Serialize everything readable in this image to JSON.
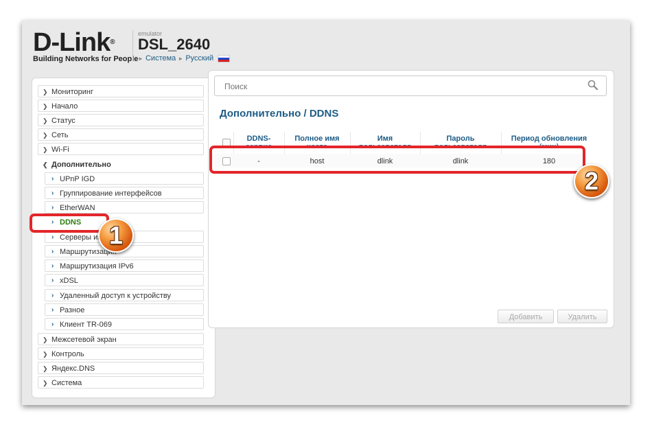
{
  "header": {
    "logo_text": "D-Link",
    "logo_reg": "®",
    "logo_tagline": "Building Networks for People",
    "emulator_label": "emulator",
    "model": "DSL_2640",
    "crumb_system": "Система",
    "crumb_language": "Русский"
  },
  "sidebar": {
    "items": [
      {
        "label": "Мониторинг"
      },
      {
        "label": "Начало"
      },
      {
        "label": "Статус"
      },
      {
        "label": "Сеть"
      },
      {
        "label": "Wi-Fi"
      },
      {
        "label": "Дополнительно"
      },
      {
        "label": "UPnP IGD"
      },
      {
        "label": "Группирование интерфейсов"
      },
      {
        "label": "EtherWAN"
      },
      {
        "label": "DDNS"
      },
      {
        "label": "Серверы имён"
      },
      {
        "label": "Маршрутизация"
      },
      {
        "label": "Маршрутизация IPv6"
      },
      {
        "label": "xDSL"
      },
      {
        "label": "Удаленный доступ к устройству"
      },
      {
        "label": "Разное"
      },
      {
        "label": "Клиент TR-069"
      },
      {
        "label": "Межсетевой экран"
      },
      {
        "label": "Контроль"
      },
      {
        "label": "Яндекс.DNS"
      },
      {
        "label": "Система"
      }
    ]
  },
  "search": {
    "placeholder": "Поиск"
  },
  "page_title": "Дополнительно /  DDNS",
  "table": {
    "columns": [
      {
        "line1": "DDNS-",
        "line2": "сервис"
      },
      {
        "line1": "Полное имя",
        "line2": "хоста"
      },
      {
        "line1": "Имя",
        "line2": "пользователя"
      },
      {
        "line1": "Пароль",
        "line2": "пользователя"
      },
      {
        "line1": "Период обновления",
        "line2": "(мин)"
      }
    ],
    "rows": [
      {
        "service": "-",
        "host": "host",
        "username": "dlink",
        "password": "dlink",
        "period": "180"
      }
    ]
  },
  "buttons": {
    "add": "Добавить",
    "delete": "Удалить"
  },
  "annotations": {
    "badge_1": "1",
    "badge_2": "2"
  },
  "colors": {
    "accent_blue": "#1d5c86",
    "active_green": "#2e7d10",
    "highlight_red": "#e2262a",
    "badge_orange": "#f49b3f"
  }
}
